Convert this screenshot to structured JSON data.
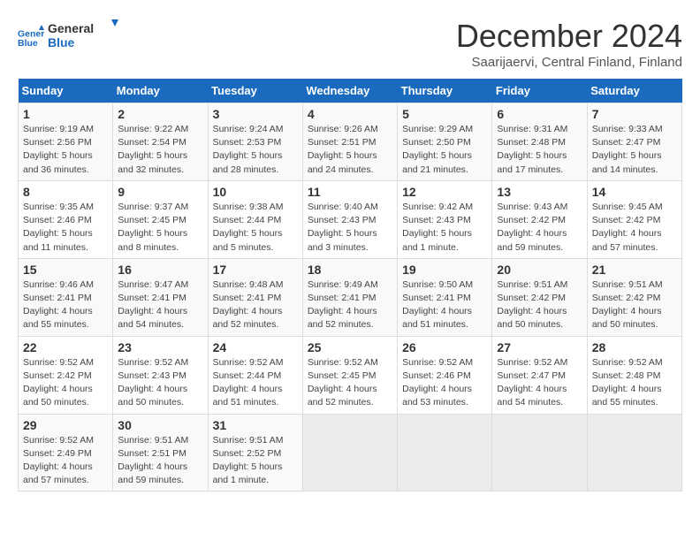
{
  "header": {
    "logo_line1": "General",
    "logo_line2": "Blue",
    "month": "December 2024",
    "location": "Saarijaervi, Central Finland, Finland"
  },
  "columns": [
    "Sunday",
    "Monday",
    "Tuesday",
    "Wednesday",
    "Thursday",
    "Friday",
    "Saturday"
  ],
  "weeks": [
    [
      {
        "day": "1",
        "detail": "Sunrise: 9:19 AM\nSunset: 2:56 PM\nDaylight: 5 hours\nand 36 minutes."
      },
      {
        "day": "2",
        "detail": "Sunrise: 9:22 AM\nSunset: 2:54 PM\nDaylight: 5 hours\nand 32 minutes."
      },
      {
        "day": "3",
        "detail": "Sunrise: 9:24 AM\nSunset: 2:53 PM\nDaylight: 5 hours\nand 28 minutes."
      },
      {
        "day": "4",
        "detail": "Sunrise: 9:26 AM\nSunset: 2:51 PM\nDaylight: 5 hours\nand 24 minutes."
      },
      {
        "day": "5",
        "detail": "Sunrise: 9:29 AM\nSunset: 2:50 PM\nDaylight: 5 hours\nand 21 minutes."
      },
      {
        "day": "6",
        "detail": "Sunrise: 9:31 AM\nSunset: 2:48 PM\nDaylight: 5 hours\nand 17 minutes."
      },
      {
        "day": "7",
        "detail": "Sunrise: 9:33 AM\nSunset: 2:47 PM\nDaylight: 5 hours\nand 14 minutes."
      }
    ],
    [
      {
        "day": "8",
        "detail": "Sunrise: 9:35 AM\nSunset: 2:46 PM\nDaylight: 5 hours\nand 11 minutes."
      },
      {
        "day": "9",
        "detail": "Sunrise: 9:37 AM\nSunset: 2:45 PM\nDaylight: 5 hours\nand 8 minutes."
      },
      {
        "day": "10",
        "detail": "Sunrise: 9:38 AM\nSunset: 2:44 PM\nDaylight: 5 hours\nand 5 minutes."
      },
      {
        "day": "11",
        "detail": "Sunrise: 9:40 AM\nSunset: 2:43 PM\nDaylight: 5 hours\nand 3 minutes."
      },
      {
        "day": "12",
        "detail": "Sunrise: 9:42 AM\nSunset: 2:43 PM\nDaylight: 5 hours\nand 1 minute."
      },
      {
        "day": "13",
        "detail": "Sunrise: 9:43 AM\nSunset: 2:42 PM\nDaylight: 4 hours\nand 59 minutes."
      },
      {
        "day": "14",
        "detail": "Sunrise: 9:45 AM\nSunset: 2:42 PM\nDaylight: 4 hours\nand 57 minutes."
      }
    ],
    [
      {
        "day": "15",
        "detail": "Sunrise: 9:46 AM\nSunset: 2:41 PM\nDaylight: 4 hours\nand 55 minutes."
      },
      {
        "day": "16",
        "detail": "Sunrise: 9:47 AM\nSunset: 2:41 PM\nDaylight: 4 hours\nand 54 minutes."
      },
      {
        "day": "17",
        "detail": "Sunrise: 9:48 AM\nSunset: 2:41 PM\nDaylight: 4 hours\nand 52 minutes."
      },
      {
        "day": "18",
        "detail": "Sunrise: 9:49 AM\nSunset: 2:41 PM\nDaylight: 4 hours\nand 52 minutes."
      },
      {
        "day": "19",
        "detail": "Sunrise: 9:50 AM\nSunset: 2:41 PM\nDaylight: 4 hours\nand 51 minutes."
      },
      {
        "day": "20",
        "detail": "Sunrise: 9:51 AM\nSunset: 2:42 PM\nDaylight: 4 hours\nand 50 minutes."
      },
      {
        "day": "21",
        "detail": "Sunrise: 9:51 AM\nSunset: 2:42 PM\nDaylight: 4 hours\nand 50 minutes."
      }
    ],
    [
      {
        "day": "22",
        "detail": "Sunrise: 9:52 AM\nSunset: 2:42 PM\nDaylight: 4 hours\nand 50 minutes."
      },
      {
        "day": "23",
        "detail": "Sunrise: 9:52 AM\nSunset: 2:43 PM\nDaylight: 4 hours\nand 50 minutes."
      },
      {
        "day": "24",
        "detail": "Sunrise: 9:52 AM\nSunset: 2:44 PM\nDaylight: 4 hours\nand 51 minutes."
      },
      {
        "day": "25",
        "detail": "Sunrise: 9:52 AM\nSunset: 2:45 PM\nDaylight: 4 hours\nand 52 minutes."
      },
      {
        "day": "26",
        "detail": "Sunrise: 9:52 AM\nSunset: 2:46 PM\nDaylight: 4 hours\nand 53 minutes."
      },
      {
        "day": "27",
        "detail": "Sunrise: 9:52 AM\nSunset: 2:47 PM\nDaylight: 4 hours\nand 54 minutes."
      },
      {
        "day": "28",
        "detail": "Sunrise: 9:52 AM\nSunset: 2:48 PM\nDaylight: 4 hours\nand 55 minutes."
      }
    ],
    [
      {
        "day": "29",
        "detail": "Sunrise: 9:52 AM\nSunset: 2:49 PM\nDaylight: 4 hours\nand 57 minutes."
      },
      {
        "day": "30",
        "detail": "Sunrise: 9:51 AM\nSunset: 2:51 PM\nDaylight: 4 hours\nand 59 minutes."
      },
      {
        "day": "31",
        "detail": "Sunrise: 9:51 AM\nSunset: 2:52 PM\nDaylight: 5 hours\nand 1 minute."
      },
      {
        "day": "",
        "detail": ""
      },
      {
        "day": "",
        "detail": ""
      },
      {
        "day": "",
        "detail": ""
      },
      {
        "day": "",
        "detail": ""
      }
    ]
  ]
}
